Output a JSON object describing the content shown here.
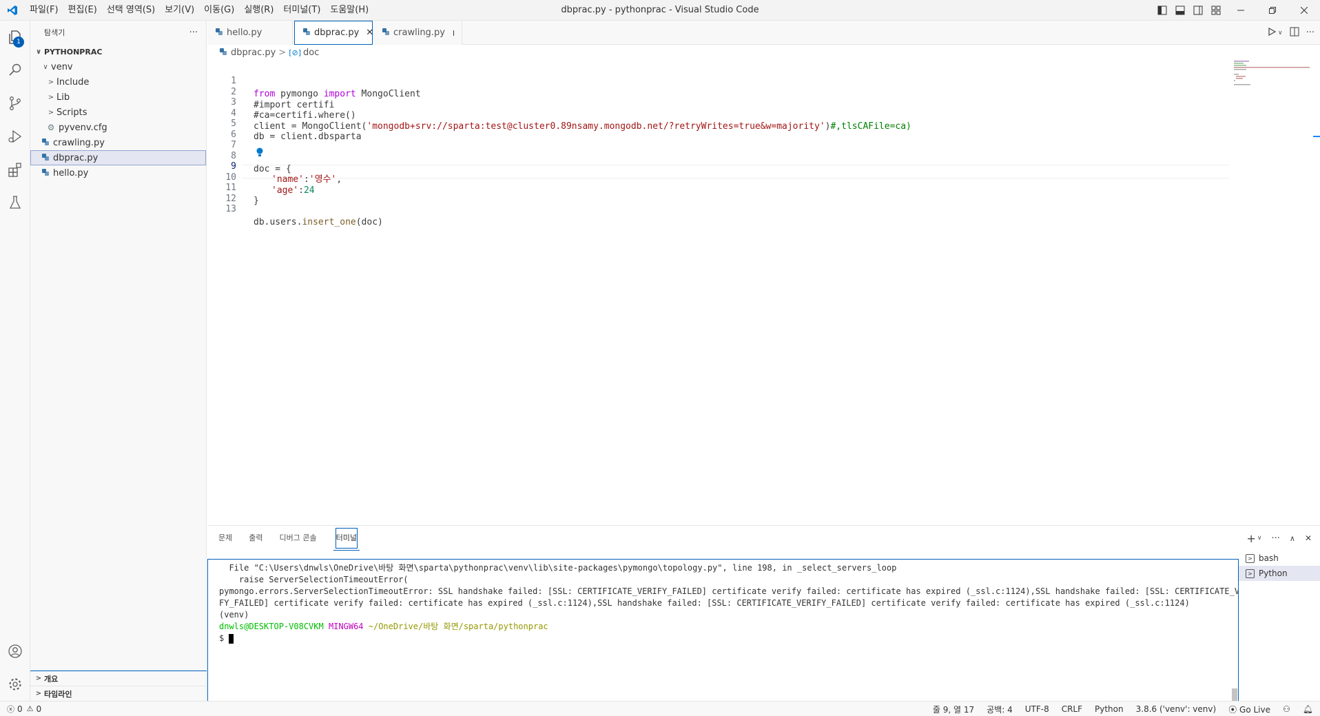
{
  "window": {
    "title": "dbprac.py - pythonprac - Visual Studio Code"
  },
  "menu": [
    "파일(F)",
    "편집(E)",
    "선택 영역(S)",
    "보기(V)",
    "이동(G)",
    "실행(R)",
    "터미널(T)",
    "도움말(H)"
  ],
  "activity": {
    "explorer_badge": "1"
  },
  "sidebar": {
    "title": "탐색기",
    "more": "···",
    "root": "PYTHONPRAC",
    "venv": "venv",
    "include": "Include",
    "lib": "Lib",
    "scripts": "Scripts",
    "pyvenv": "pyvenv.cfg",
    "crawling": "crawling.py",
    "dbprac": "dbprac.py",
    "hello": "hello.py",
    "outline": "개요",
    "timeline": "타임라인"
  },
  "tabs": [
    {
      "label": "hello.py"
    },
    {
      "label": "dbprac.py"
    },
    {
      "label": "crawling.py"
    }
  ],
  "breadcrumb": {
    "file": "dbprac.py",
    "symbol": "doc"
  },
  "code": {
    "ln": [
      "1",
      "2",
      "3",
      "4",
      "5",
      "6",
      "7",
      "8",
      "9",
      "10",
      "11",
      "12",
      "13"
    ],
    "l1_from": "from",
    "l1_mod": " pymongo ",
    "l1_import": "import",
    "l1_rest": " MongoClient",
    "l2": "#import certifi",
    "l3": "#ca=certifi.where()",
    "l4_a": "client = MongoClient(",
    "l4_str": "'mongodb+srv://sparta:test@cluster0.89nsamy.mongodb.net/?retryWrites=true&w=majority'",
    "l4_b": ")",
    "l4_cm": "#,tlsCAFile=ca)",
    "l5": "db = client.dbsparta",
    "l8": "doc = {",
    "l9_key": "'name'",
    "l9_colon": ":",
    "l9_val": "'영수'",
    "l9_comma": ",",
    "l10_key": "'age'",
    "l10_colon": ":",
    "l10_val": "24",
    "l11": "}",
    "l13_a": "db.users.",
    "l13_fn": "insert_one",
    "l13_b": "(doc)"
  },
  "panel": {
    "tabs": [
      "문제",
      "출력",
      "디버그 콘솔",
      "터미널"
    ],
    "terminal": {
      "line1": "  File \"C:\\Users\\dnwls\\OneDrive\\바탕 화면\\sparta\\pythonprac\\venv\\lib\\site-packages\\pymongo\\topology.py\", line 198, in _select_servers_loop",
      "line2": "    raise ServerSelectionTimeoutError(",
      "line3": "pymongo.errors.ServerSelectionTimeoutError: SSL handshake failed: [SSL: CERTIFICATE_VERIFY_FAILED] certificate verify failed: certificate has expired (_ssl.c:1124),SSL handshake failed: [SSL: CERTIFICATE_VERI",
      "line4": "FY_FAILED] certificate verify failed: certificate has expired (_ssl.c:1124),SSL handshake failed: [SSL: CERTIFICATE_VERIFY_FAILED] certificate verify failed: certificate has expired (_ssl.c:1124)",
      "line5": "(venv)",
      "prompt_user": "dnwls@DESKTOP-V08CVKM",
      "prompt_sys": " MINGW64 ",
      "prompt_path": "~/OneDrive/바탕 화면/sparta/pythonprac",
      "prompt_symbol": "$ "
    },
    "terminals": [
      "bash",
      "Python"
    ]
  },
  "status": {
    "errors": "0",
    "warnings": "0",
    "position": "줄 9, 열 17",
    "spaces": "공백: 4",
    "encoding": "UTF-8",
    "eol": "CRLF",
    "language": "Python",
    "interpreter": "3.8.6 ('venv': venv)",
    "golive": "Go Live"
  },
  "colors": {
    "accent": "#005fb8",
    "keyword": "#af00db",
    "comment": "#008000",
    "string": "#a31515"
  }
}
